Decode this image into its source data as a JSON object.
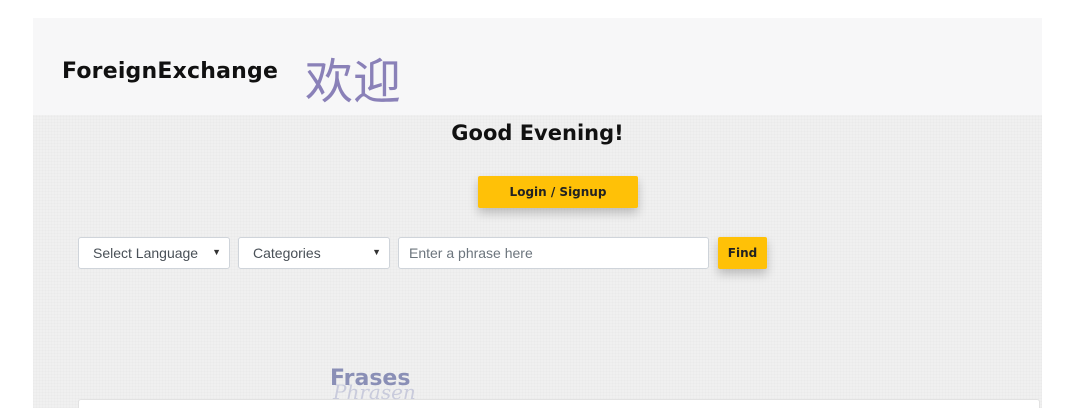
{
  "header": {
    "brand": "ForeignExchange",
    "welcome": "欢迎"
  },
  "main": {
    "greeting": "Good Evening!",
    "login_label": "Login / Signup"
  },
  "search": {
    "language_select": "Select Language",
    "category_select": "Categories",
    "phrase_placeholder": "Enter a phrase here",
    "find_label": "Find"
  },
  "section": {
    "title": "Frases",
    "subtitle": "Phrasen"
  },
  "colors": {
    "accent": "#ffc107",
    "welcome_text": "#8a81b8",
    "background": "#f0f0f0"
  }
}
